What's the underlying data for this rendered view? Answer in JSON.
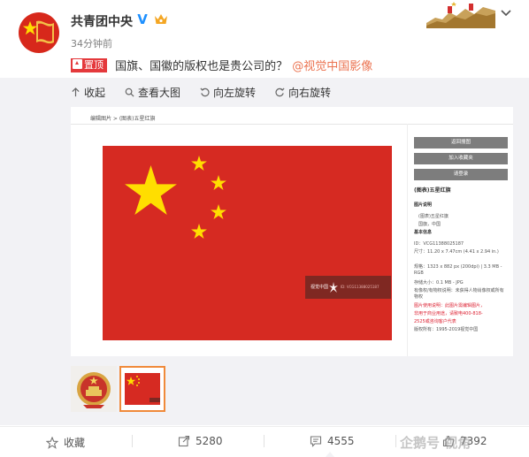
{
  "post": {
    "user_name": "共青团中央",
    "verified_icon": "verified-v-icon",
    "vip_icon": "crown-icon",
    "time": "34分钟前",
    "pin_label": "置顶",
    "text": "国旗、国徽的版权也是贵公司的？",
    "mention": "@视觉中国影像"
  },
  "toolbar": {
    "collapse": "收起",
    "view_large": "查看大图",
    "rotate_left": "向左旋转",
    "rotate_right": "向右旋转"
  },
  "preview": {
    "breadcrumb": "编辑图片 > (图表)五星红旗",
    "watermark_brand": "视觉中国",
    "watermark_id": "ID: VCG11388025187",
    "side_buttons": [
      "返回搜图",
      "加入收藏夹",
      "请登录"
    ],
    "title": "(图表)五星红旗",
    "info": {
      "desc_heading": "图片说明",
      "desc_1": "(图表)五星红旗",
      "desc_2": "国旗，中国",
      "basic_heading": "基本信息",
      "id": "ID：VCG11388025187",
      "size": "尺寸：11.20 x 7.47cm (4.41 x 2.94 in.)",
      "spec": "规格：1323 x 882 px (200dpi) | 3.3 MB - RGB",
      "store": "存储大小：0.1 MB - JPG",
      "auth": "有像权/有物权说明：未获得人物肖像权或所有物权",
      "use_1": "图片使用说明：此图片需编辑图片，",
      "use_2": "非用于商业用途，请致电400-818-",
      "use_3": "2525或咨询客户代表",
      "copyright": "版权所有：1995-2019视觉中国"
    }
  },
  "actions": {
    "favorite": "收藏",
    "repost": "5280",
    "comment": "4555",
    "like": "7392"
  },
  "corner_watermark": "企鹅号 视角",
  "colors": {
    "flag_red": "#d62a22",
    "star_yellow": "#ffde00",
    "pin_red": "#e4393c",
    "link_orange": "#eb7350",
    "thumb_border": "#f08a3a"
  }
}
